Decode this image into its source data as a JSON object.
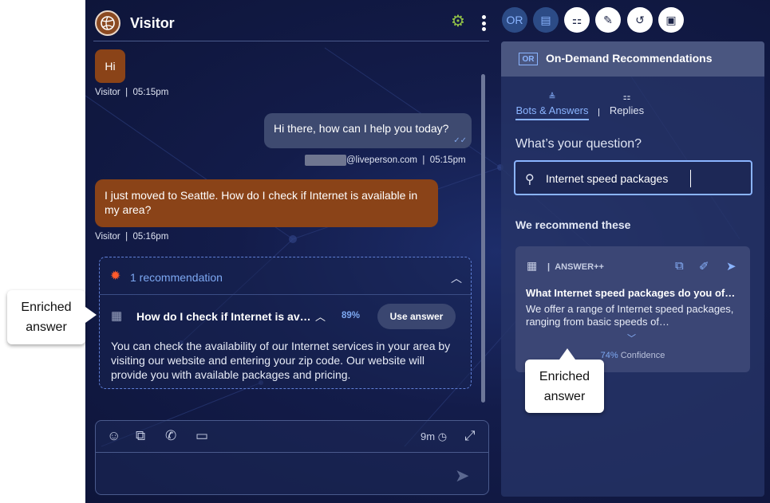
{
  "header": {
    "title": "Visitor"
  },
  "toolbar": {
    "or_label": "OR"
  },
  "messages": [
    {
      "text": "Hi",
      "sender": "Visitor",
      "time": "05:15pm"
    },
    {
      "text": "Hi there, how can I help you today?",
      "sender": "@liveperson.com",
      "time": "05:15pm"
    },
    {
      "text": "I just moved to Seattle. How do I check if Internet is available in my area?",
      "sender": "Visitor",
      "time": "05:16pm"
    }
  ],
  "meta_separator": "|",
  "recommendation": {
    "count_label": "1 recommendation",
    "question": "How do I check if Internet is available in my area?",
    "percent": "89%",
    "use_button": "Use answer",
    "body": "You can check the availability of our Internet services in your area by visiting our website and entering your zip code. Our website will provide you with available packages and pricing."
  },
  "composer": {
    "timer": "9m"
  },
  "od_panel": {
    "badge": "OR",
    "title": "On-Demand Recommendations",
    "tabs": [
      {
        "label": "Bots & Answers"
      },
      {
        "label": "Replies"
      }
    ],
    "question_label": "What’s your question?",
    "search_value": "Internet speed packages",
    "recommend_label": "We recommend these",
    "answer": {
      "type": "ANSWER++",
      "title": "What Internet speed packages do you offer?",
      "body": "We offer a range of Internet speed packages, ranging from basic speeds of…",
      "confidence_pct": "74%",
      "confidence_label": "Confidence"
    }
  },
  "callouts": {
    "left": "Enriched answer",
    "right": "Enriched answer"
  }
}
